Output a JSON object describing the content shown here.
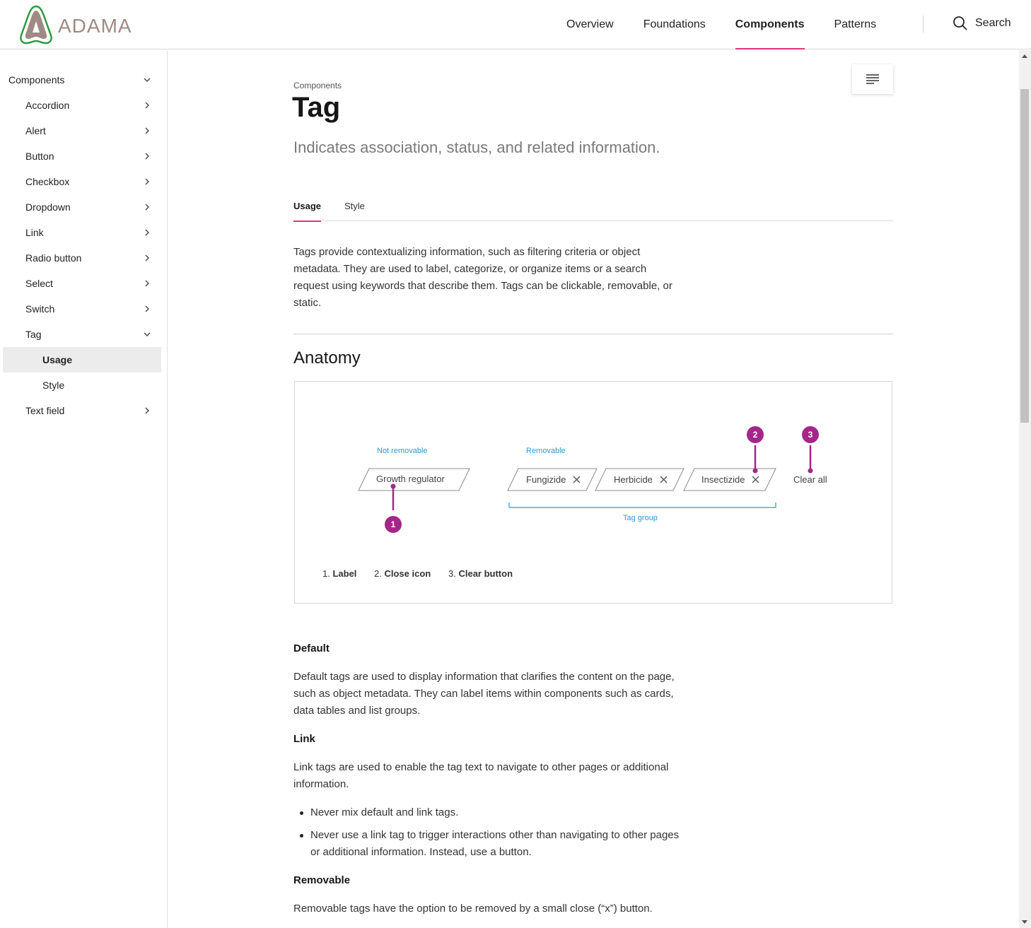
{
  "header": {
    "brand": "ADAMA",
    "nav": [
      "Overview",
      "Foundations",
      "Components",
      "Patterns"
    ],
    "active_nav": "Components",
    "search_label": "Search"
  },
  "sidebar": {
    "items": [
      {
        "label": "Components",
        "level": 0,
        "chevron": "down"
      },
      {
        "label": "Accordion",
        "level": 1,
        "chevron": "right"
      },
      {
        "label": "Alert",
        "level": 1,
        "chevron": "right"
      },
      {
        "label": "Button",
        "level": 1,
        "chevron": "right"
      },
      {
        "label": "Checkbox",
        "level": 1,
        "chevron": "right"
      },
      {
        "label": "Dropdown",
        "level": 1,
        "chevron": "right"
      },
      {
        "label": "Link",
        "level": 1,
        "chevron": "right"
      },
      {
        "label": "Radio button",
        "level": 1,
        "chevron": "right"
      },
      {
        "label": "Select",
        "level": 1,
        "chevron": "right"
      },
      {
        "label": "Switch",
        "level": 1,
        "chevron": "right"
      },
      {
        "label": "Tag",
        "level": 1,
        "chevron": "down"
      },
      {
        "label": "Usage",
        "level": 2,
        "chevron": "",
        "active": true
      },
      {
        "label": "Style",
        "level": 2,
        "chevron": ""
      },
      {
        "label": "Text field",
        "level": 1,
        "chevron": "right"
      }
    ]
  },
  "page": {
    "breadcrumb": "Components",
    "title": "Tag",
    "subtitle": "Indicates association, status, and related information.",
    "tabs": [
      "Usage",
      "Style"
    ],
    "intro": "Tags provide contextualizing information, such as filtering criteria or object metadata. They are used to label, categorize, or organize items or a search request using keywords that describe them. Tags can be clickable, removable, or static.",
    "anatomy_heading": "Anatomy",
    "anatomy": {
      "not_removable_label": "Not removable",
      "removable_label": "Removable",
      "tag_static": "Growth regulator",
      "tags_removable": [
        "Fungizide",
        "Herbicide",
        "Insectizide"
      ],
      "clear_all": "Clear all",
      "tag_group_label": "Tag group",
      "markers": [
        "1",
        "2",
        "3"
      ],
      "legend": [
        {
          "num": "1.",
          "label": "Label"
        },
        {
          "num": "2.",
          "label": "Close icon"
        },
        {
          "num": "3.",
          "label": "Clear button"
        }
      ]
    },
    "default_heading": "Default",
    "default_text": "Default tags are used to display information that clarifies the content on the page, such as object metadata. They can label items within components such as cards, data tables and list groups.",
    "link_heading": "Link",
    "link_text": "Link tags are used to enable the tag text to navigate to other pages or additional information.",
    "link_bullets": [
      "Never mix default and link tags.",
      "Never use a link tag to trigger interactions other than navigating to other pages or additional information. Instead, use a button."
    ],
    "removable_heading": "Removable",
    "removable_text": "Removable tags have the option to be removed by a small close (“x”) button."
  },
  "colors": {
    "accent_pink": "#e0357b",
    "marker_purple": "#a4268a",
    "annotation_blue": "#2d9bd4",
    "logo_green": "#2e9a3f",
    "logo_taupe": "#a08a85"
  }
}
